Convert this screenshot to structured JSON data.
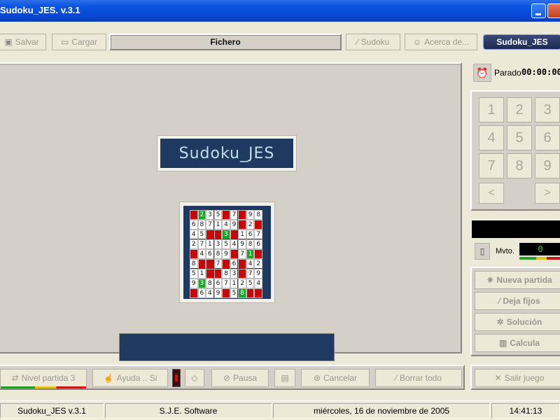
{
  "window": {
    "title": "Sudoku_JES. v.3.1"
  },
  "toolbar": {
    "salvar": "Salvar",
    "cargar": "Cargar",
    "fichero": "Fichero",
    "sudoku": "Sudoku",
    "acerca": "Acerca de...",
    "tab": "Sudoku_JES"
  },
  "board": {
    "logo_text": "Sudoku_JES",
    "mini_grid": [
      [
        "r",
        "g:2",
        "3",
        "5",
        "r",
        "7",
        "r",
        "9",
        "8"
      ],
      [
        "6",
        "8",
        "7",
        "1",
        "4",
        "9",
        "r",
        "2",
        "r"
      ],
      [
        "4",
        "5",
        "r",
        "r",
        "g:3",
        "r",
        "1",
        "6",
        "7"
      ],
      [
        "2",
        "7",
        "1",
        "3",
        "5",
        "4",
        "9",
        "8",
        "6"
      ],
      [
        "r",
        "4",
        "6",
        "8",
        "9",
        "r",
        "7",
        "g:1",
        "r"
      ],
      [
        "8",
        "r",
        "r",
        "7",
        "r",
        "6",
        "r",
        "4",
        "2"
      ],
      [
        "5",
        "1",
        "r",
        "r",
        "8",
        "3",
        "r",
        "7",
        "9"
      ],
      [
        "9",
        "g:3",
        "8",
        "6",
        "7",
        "1",
        "2",
        "5",
        "4"
      ],
      [
        "r",
        "6",
        "4",
        "9",
        "r",
        "5",
        "g:8",
        "r",
        "r"
      ]
    ]
  },
  "bottom": {
    "nivel": "Nivel partida 3",
    "ayuda": "Ayuda .. Si",
    "pausa": "Pausa",
    "cancelar": "Cancelar",
    "borrar": "Borrar todo",
    "salir": "Salir juego"
  },
  "timer": {
    "status": "Parado",
    "value": "00:00:00"
  },
  "numpad": [
    "1",
    "2",
    "3",
    "4",
    "5",
    "6",
    "7",
    "8",
    "9"
  ],
  "arrows": {
    "left": "<",
    "right": ">"
  },
  "moves": {
    "label": "Mvto.",
    "value": "0"
  },
  "actions": {
    "nueva": "Nueva partida",
    "deja": "Deja fijos",
    "solucion": "Solución",
    "calcula": "Calcula"
  },
  "status": {
    "app": "Sudoku_JES  v.3.1",
    "company": "S.J.E. Software",
    "date": "miércoles, 16 de noviembre de 2005",
    "time": "14:41:13"
  },
  "icons": {
    "save": "floppy-icon",
    "open": "folder-icon",
    "wand": "wand-icon",
    "smile": "smiley-icon",
    "alarm": "alarm-clock-icon",
    "phone": "mobile-icon"
  },
  "colors": {
    "panel_dark": "#1f3a60",
    "cell_red": "#c80808",
    "cell_green": "#18a828"
  }
}
